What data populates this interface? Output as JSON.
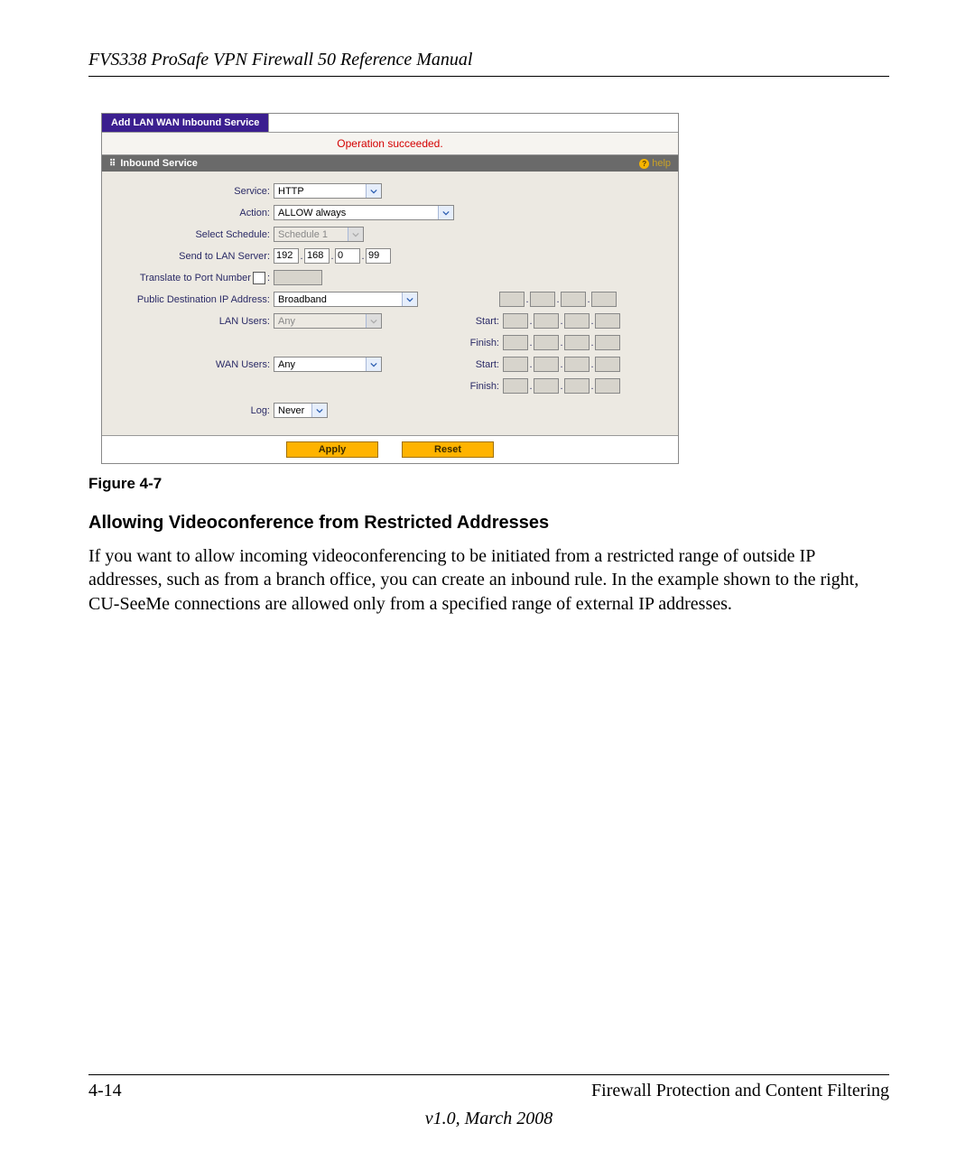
{
  "doc_header": "FVS338 ProSafe VPN Firewall 50 Reference Manual",
  "screenshot": {
    "tab_title": "Add LAN WAN Inbound Service",
    "status": "Operation succeeded.",
    "section_title": "Inbound Service",
    "help_label": "help",
    "labels": {
      "service": "Service:",
      "action": "Action:",
      "schedule": "Select Schedule:",
      "send_to_lan": "Send to LAN Server:",
      "translate_port": "Translate to Port Number",
      "translate_colon": ":",
      "public_dest": "Public Destination IP Address:",
      "lan_users": "LAN Users:",
      "wan_users": "WAN Users:",
      "log": "Log:",
      "start": "Start:",
      "finish": "Finish:"
    },
    "values": {
      "service": "HTTP",
      "action": "ALLOW always",
      "schedule": "Schedule 1",
      "ip": [
        "192",
        "168",
        "0",
        "99"
      ],
      "public_dest": "Broadband",
      "lan_users": "Any",
      "wan_users": "Any",
      "log": "Never"
    },
    "buttons": {
      "apply": "Apply",
      "reset": "Reset"
    }
  },
  "figure_caption": "Figure 4-7",
  "section_heading": "Allowing Videoconference from Restricted Addresses",
  "body": "If you want to allow incoming videoconferencing to be initiated from a restricted range of outside IP addresses, such as from a branch office, you can create an inbound rule. In the example shown to the right, CU-SeeMe connections are allowed only from a specified range of external IP addresses.",
  "footer": {
    "page": "4-14",
    "chapter": "Firewall Protection and Content Filtering",
    "version": "v1.0, March 2008"
  }
}
